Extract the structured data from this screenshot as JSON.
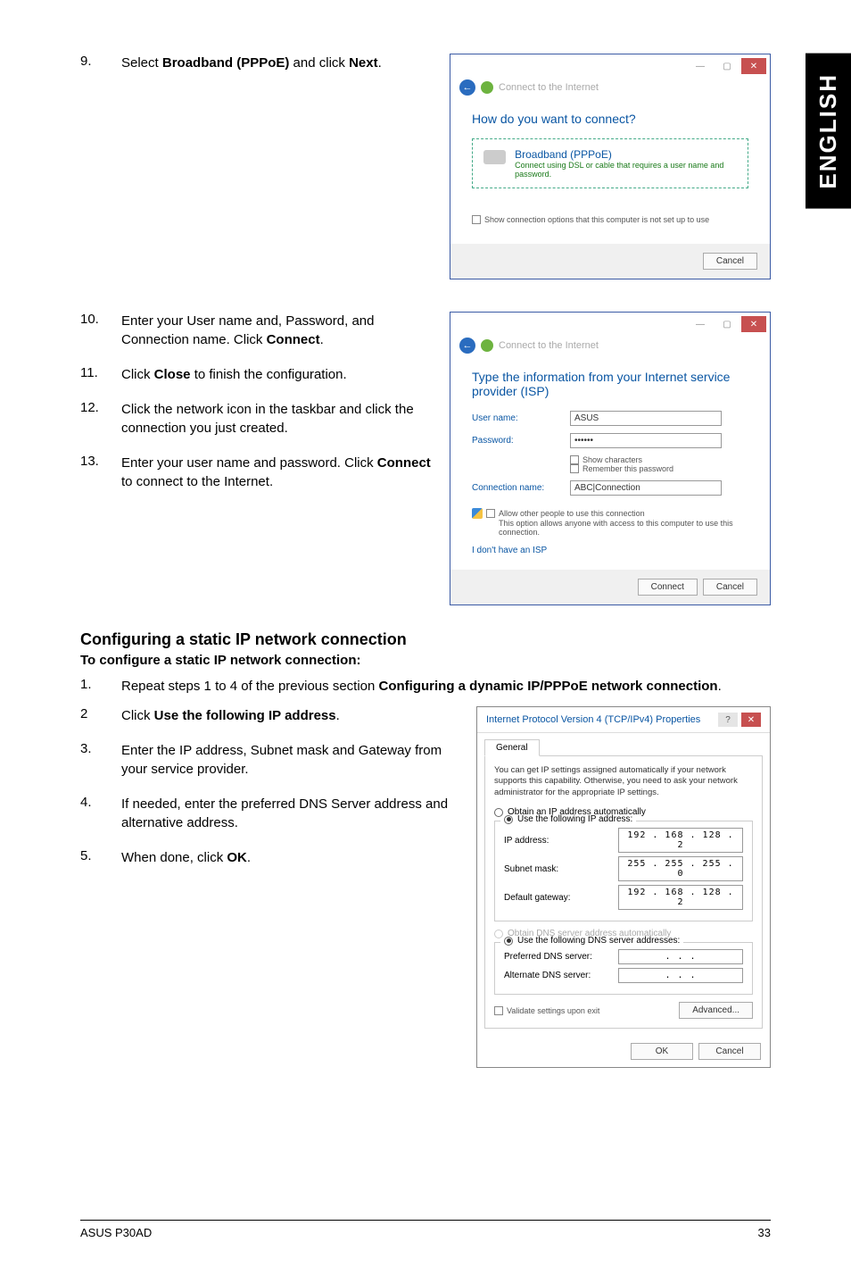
{
  "english_tab": "ENGLISH",
  "top_step": {
    "num": "9.",
    "text_a": "Select ",
    "text_b": "Broadband (PPPoE)",
    "text_c": " and click ",
    "text_d": "Next",
    "text_e": "."
  },
  "dialog1": {
    "header_title": "Connect to the Internet",
    "heading": "How do you want to connect?",
    "option_title": "Broadband (PPPoE)",
    "option_desc": "Connect using DSL or cable that requires a user name and password.",
    "show_opts": "Show connection options that this computer is not set up to use",
    "cancel": "Cancel"
  },
  "mid_steps": [
    {
      "num": "10.",
      "text": "Enter your User name and, Password, and Connection name. Click ",
      "bold": "Connect",
      "tail": "."
    },
    {
      "num": "11.",
      "text": "Click ",
      "bold": "Close",
      "tail": " to finish the configuration."
    },
    {
      "num": "12.",
      "text": "Click the network icon in the taskbar and click the connection you just created.",
      "bold": "",
      "tail": ""
    },
    {
      "num": "13.",
      "text": "Enter your user name and password. Click ",
      "bold": "Connect",
      "tail": " to connect to the Internet."
    }
  ],
  "dialog2": {
    "header_title": "Connect to the Internet",
    "heading": "Type the information from your Internet service provider (ISP)",
    "user_label": "User name:",
    "user_val": "ASUS",
    "pass_label": "Password:",
    "pass_val": "••••••",
    "show_chars": "Show characters",
    "remember": "Remember this password",
    "conn_label": "Connection name:",
    "conn_val": "ABC|Connection",
    "allow_label": "Allow other people to use this connection",
    "allow_desc": "This option allows anyone with access to this computer to use this connection.",
    "no_isp": "I don't have an ISP",
    "connect": "Connect",
    "cancel": "Cancel"
  },
  "section_heading": "Configuring a static IP network connection",
  "section_sub": "To configure a static IP network connection:",
  "bottom_steps": [
    {
      "num": "1.",
      "pre": "Repeat steps 1 to 4 of the previous section ",
      "bold": "Configuring a dynamic IP/PPPoE network connection",
      "post": "."
    },
    {
      "num": "2",
      "pre": "Click ",
      "bold": "Use the following IP address",
      "post": "."
    },
    {
      "num": "3.",
      "pre": "Enter the IP address, Subnet mask and Gateway from your service provider.",
      "bold": "",
      "post": ""
    },
    {
      "num": "4.",
      "pre": "If needed, enter the preferred DNS Server address and alternative address.",
      "bold": "",
      "post": ""
    },
    {
      "num": "5.",
      "pre": "When done, click ",
      "bold": "OK",
      "post": "."
    }
  ],
  "ipv4": {
    "title": "Internet Protocol Version 4 (TCP/IPv4) Properties",
    "tab": "General",
    "desc": "You can get IP settings assigned automatically if your network supports this capability. Otherwise, you need to ask your network administrator for the appropriate IP settings.",
    "r1": "Obtain an IP address automatically",
    "r2": "Use the following IP address:",
    "ip_label": "IP address:",
    "ip_val": "192 . 168 . 128 .  2",
    "mask_label": "Subnet mask:",
    "mask_val": "255 . 255 . 255 .  0",
    "gw_label": "Default gateway:",
    "gw_val": "192 . 168 . 128 .  2",
    "r3": "Obtain DNS server address automatically",
    "r4": "Use the following DNS server addresses:",
    "pref_label": "Preferred DNS server:",
    "pref_val": ".      .      .",
    "alt_label": "Alternate DNS server:",
    "alt_val": ".      .      .",
    "validate": "Validate settings upon exit",
    "advanced": "Advanced...",
    "ok": "OK",
    "cancel": "Cancel"
  },
  "footer": {
    "model": "ASUS P30AD",
    "page": "33"
  }
}
